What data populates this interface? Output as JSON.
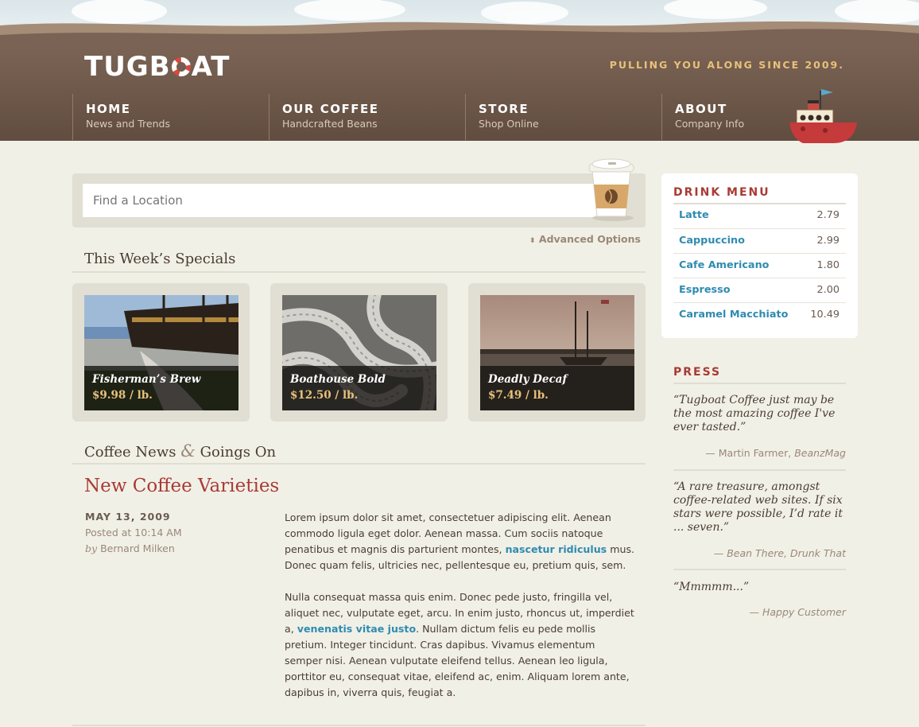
{
  "header": {
    "logo": "TUGBOAT",
    "tagline": "PULLING YOU ALONG SINCE 2009.",
    "nav": [
      {
        "title": "HOME",
        "sub": "News and Trends"
      },
      {
        "title": "OUR COFFEE",
        "sub": "Handcrafted Beans"
      },
      {
        "title": "STORE",
        "sub": "Shop Online"
      },
      {
        "title": "ABOUT",
        "sub": "Company Info"
      }
    ]
  },
  "search": {
    "placeholder": "Find a Location",
    "advanced": "Advanced Options"
  },
  "specials": {
    "title": "This Week’s Specials",
    "items": [
      {
        "name": "Fisherman’s Brew",
        "price": "$9.98 / lb."
      },
      {
        "name": "Boathouse Bold",
        "price": "$12.50 / lb."
      },
      {
        "name": "Deadly Decaf",
        "price": "$7.49 / lb."
      }
    ]
  },
  "news": {
    "title_a": "Coffee News",
    "amp": "&",
    "title_b": "Goings On",
    "post": {
      "title": "New Coffee Varieties",
      "date": "MAY 13, 2009",
      "time": "Posted at 10:14 AM",
      "by": "by",
      "author": "Bernard Milken",
      "p1a": "Lorem ipsum dolor sit amet, consectetuer adipiscing elit. Aenean commodo ligula eget dolor. Aenean massa. Cum sociis natoque penatibus et magnis dis parturient montes, ",
      "p1link": "nascetur ridiculus",
      "p1b": " mus. Donec quam felis, ultricies nec, pellentesque eu, pretium quis, sem.",
      "p2a": "Nulla consequat massa quis enim. Donec pede justo, fringilla vel, aliquet nec, vulputate eget, arcu. In enim justo, rhoncus ut, imperdiet a, ",
      "p2link": "venenatis vitae justo",
      "p2b": ". Nullam dictum felis eu pede mollis pretium. Integer tincidunt. Cras dapibus. Vivamus elementum semper nisi. Aenean vulputate eleifend tellus. Aenean leo ligula, porttitor eu, consequat vitae, eleifend ac, enim. Aliquam lorem ante, dapibus in, viverra quis, feugiat a."
    }
  },
  "drink_menu": {
    "title": "DRINK MENU",
    "items": [
      {
        "name": "Latte",
        "price": "2.79"
      },
      {
        "name": "Cappuccino",
        "price": "2.99"
      },
      {
        "name": "Cafe Americano",
        "price": "1.80"
      },
      {
        "name": "Espresso",
        "price": "2.00"
      },
      {
        "name": "Caramel Macchiato",
        "price": "10.49"
      }
    ]
  },
  "press": {
    "title": "PRESS",
    "quotes": [
      {
        "text": "“Tugboat Coffee just may be the most amazing coffee I've ever tasted.”",
        "author": "— Martin Farmer, ",
        "source": "BeanzMag"
      },
      {
        "text": "“A rare treasure, amongst coffee-related web sites. If six stars were possible, I’d rate it ... seven.”",
        "author": "— Bean There, Drunk That",
        "source": ""
      },
      {
        "text": "“Mmmmm...”",
        "author": "— Happy Customer",
        "source": ""
      }
    ]
  },
  "colors": {
    "header_brown": "#6f5a4c",
    "accent_red": "#a83b35",
    "link_blue": "#2f8bb0",
    "gold": "#e8c17a"
  }
}
